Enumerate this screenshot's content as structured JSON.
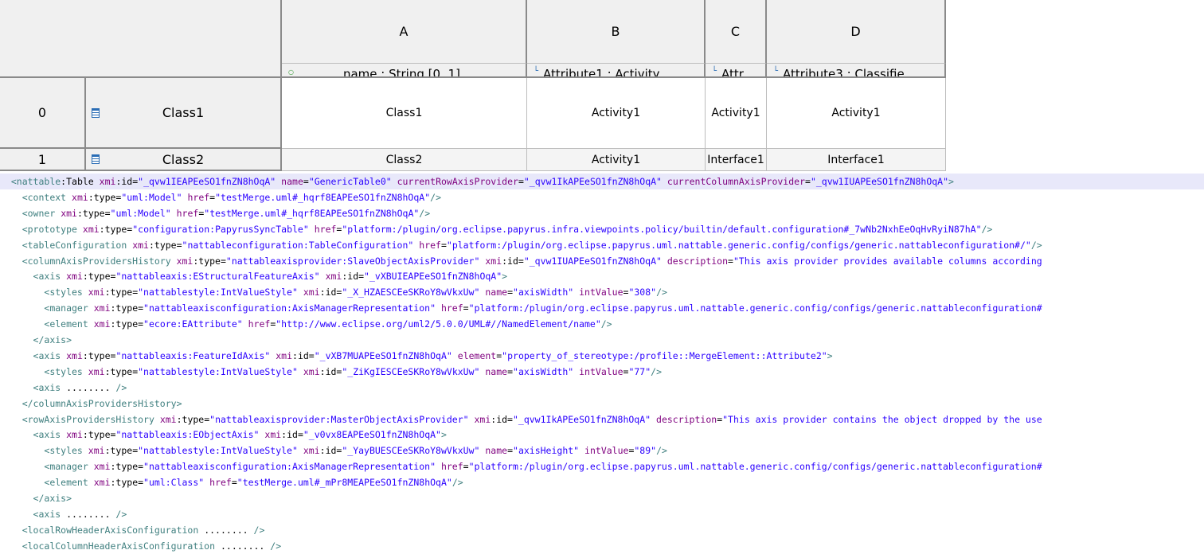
{
  "table": {
    "columns": [
      {
        "letter": "A",
        "label": "name : String [0..1]",
        "icon": "feature-dot-icon"
      },
      {
        "letter": "B",
        "label": "Attribute1 : Activity",
        "icon": "attribute-icon"
      },
      {
        "letter": "C",
        "label": "Attr",
        "icon": "attribute-icon"
      },
      {
        "letter": "D",
        "label": "Attribute3 : Classifie",
        "icon": "attribute-icon"
      }
    ],
    "rows": [
      {
        "index": "0",
        "label": "Class1",
        "cells": [
          "Class1",
          "Activity1",
          "Activity1",
          "Activity1"
        ]
      },
      {
        "index": "1",
        "label": "Class2",
        "cells": [
          "Class2",
          "Activity1",
          "Interface1",
          "Interface1"
        ]
      }
    ]
  },
  "xmi": {
    "lines": [
      {
        "indent": 2,
        "tag_prefix": "<",
        "tag": "nattable",
        "tag_rest": ":Table",
        "parts": [
          [
            "attr",
            "xmi"
          ],
          [
            "plain",
            ":id="
          ],
          [
            "val",
            "\"_qvw1IEAPEeSO1fnZN8hOqA\""
          ],
          [
            "plain",
            " "
          ],
          [
            "attr",
            "name"
          ],
          [
            "plain",
            "="
          ],
          [
            "val",
            "\"GenericTable0\""
          ],
          [
            "plain",
            " "
          ],
          [
            "attr",
            "currentRowAxisProvider"
          ],
          [
            "plain",
            "="
          ],
          [
            "val",
            "\"_qvw1IkAPEeSO1fnZN8hOqA\""
          ],
          [
            "plain",
            " "
          ],
          [
            "attr",
            "currentColumnAxisProvider"
          ],
          [
            "plain",
            "="
          ],
          [
            "val",
            "\"_qvw1IUAPEeSO1fnZN8hOqA\""
          ],
          [
            "tag",
            ">"
          ]
        ]
      },
      {
        "indent": 4,
        "tag_prefix": "<",
        "tag": "context",
        "tag_rest": "",
        "parts": [
          [
            "attr",
            "xmi"
          ],
          [
            "plain",
            ":type="
          ],
          [
            "val",
            "\"uml:Model\""
          ],
          [
            "plain",
            " "
          ],
          [
            "attr",
            "href"
          ],
          [
            "plain",
            "="
          ],
          [
            "val",
            "\"testMerge.uml#_hqrf8EAPEeSO1fnZN8hOqA\""
          ],
          [
            "tag",
            "/>"
          ]
        ]
      },
      {
        "indent": 4,
        "tag_prefix": "<",
        "tag": "owner",
        "tag_rest": "",
        "parts": [
          [
            "attr",
            "xmi"
          ],
          [
            "plain",
            ":type="
          ],
          [
            "val",
            "\"uml:Model\""
          ],
          [
            "plain",
            " "
          ],
          [
            "attr",
            "href"
          ],
          [
            "plain",
            "="
          ],
          [
            "val",
            "\"testMerge.uml#_hqrf8EAPEeSO1fnZN8hOqA\""
          ],
          [
            "tag",
            "/>"
          ]
        ]
      },
      {
        "indent": 4,
        "tag_prefix": "<",
        "tag": "prototype",
        "tag_rest": "",
        "parts": [
          [
            "attr",
            "xmi"
          ],
          [
            "plain",
            ":type="
          ],
          [
            "val",
            "\"configuration:PapyrusSyncTable\""
          ],
          [
            "plain",
            " "
          ],
          [
            "attr",
            "href"
          ],
          [
            "plain",
            "="
          ],
          [
            "val",
            "\"platform:/plugin/org.eclipse.papyrus.infra.viewpoints.policy/builtin/default.configuration#_7wNb2NxhEeOqHvRyiN87hA\""
          ],
          [
            "tag",
            "/>"
          ]
        ]
      },
      {
        "indent": 4,
        "tag_prefix": "<",
        "tag": "tableConfiguration",
        "tag_rest": "",
        "parts": [
          [
            "attr",
            "xmi"
          ],
          [
            "plain",
            ":type="
          ],
          [
            "val",
            "\"nattableconfiguration:TableConfiguration\""
          ],
          [
            "plain",
            " "
          ],
          [
            "attr",
            "href"
          ],
          [
            "plain",
            "="
          ],
          [
            "val",
            "\"platform:/plugin/org.eclipse.papyrus.uml.nattable.generic.config/configs/generic.nattableconfiguration#/\""
          ],
          [
            "tag",
            "/>"
          ]
        ]
      },
      {
        "indent": 4,
        "tag_prefix": "<",
        "tag": "columnAxisProvidersHistory",
        "tag_rest": "",
        "parts": [
          [
            "attr",
            "xmi"
          ],
          [
            "plain",
            ":type="
          ],
          [
            "val",
            "\"nattableaxisprovider:SlaveObjectAxisProvider\""
          ],
          [
            "plain",
            " "
          ],
          [
            "attr",
            "xmi"
          ],
          [
            "plain",
            ":id="
          ],
          [
            "val",
            "\"_qvw1IUAPEeSO1fnZN8hOqA\""
          ],
          [
            "plain",
            " "
          ],
          [
            "attr",
            "description"
          ],
          [
            "plain",
            "="
          ],
          [
            "val",
            "\"This axis provider provides available columns according"
          ]
        ]
      },
      {
        "indent": 6,
        "tag_prefix": "<",
        "tag": "axis",
        "tag_rest": "",
        "parts": [
          [
            "attr",
            "xmi"
          ],
          [
            "plain",
            ":type="
          ],
          [
            "val",
            "\"nattableaxis:EStructuralFeatureAxis\""
          ],
          [
            "plain",
            " "
          ],
          [
            "attr",
            "xmi"
          ],
          [
            "plain",
            ":id="
          ],
          [
            "val",
            "\"_vXBUIEAPEeSO1fnZN8hOqA\""
          ],
          [
            "tag",
            ">"
          ]
        ]
      },
      {
        "indent": 8,
        "tag_prefix": "<",
        "tag": "styles",
        "tag_rest": "",
        "parts": [
          [
            "attr",
            "xmi"
          ],
          [
            "plain",
            ":type="
          ],
          [
            "val",
            "\"nattablestyle:IntValueStyle\""
          ],
          [
            "plain",
            " "
          ],
          [
            "attr",
            "xmi"
          ],
          [
            "plain",
            ":id="
          ],
          [
            "val",
            "\"_X_HZAESCEeSKRoY8wVkxUw\""
          ],
          [
            "plain",
            " "
          ],
          [
            "attr",
            "name"
          ],
          [
            "plain",
            "="
          ],
          [
            "val",
            "\"axisWidth\""
          ],
          [
            "plain",
            " "
          ],
          [
            "attr",
            "intValue"
          ],
          [
            "plain",
            "="
          ],
          [
            "val",
            "\"308\""
          ],
          [
            "tag",
            "/>"
          ]
        ]
      },
      {
        "indent": 8,
        "tag_prefix": "<",
        "tag": "manager",
        "tag_rest": "",
        "parts": [
          [
            "attr",
            "xmi"
          ],
          [
            "plain",
            ":type="
          ],
          [
            "val",
            "\"nattableaxisconfiguration:AxisManagerRepresentation\""
          ],
          [
            "plain",
            " "
          ],
          [
            "attr",
            "href"
          ],
          [
            "plain",
            "="
          ],
          [
            "val",
            "\"platform:/plugin/org.eclipse.papyrus.uml.nattable.generic.config/configs/generic.nattableconfiguration#"
          ]
        ]
      },
      {
        "indent": 8,
        "tag_prefix": "<",
        "tag": "element",
        "tag_rest": "",
        "parts": [
          [
            "attr",
            "xmi"
          ],
          [
            "plain",
            ":type="
          ],
          [
            "val",
            "\"ecore:EAttribute\""
          ],
          [
            "plain",
            " "
          ],
          [
            "attr",
            "href"
          ],
          [
            "plain",
            "="
          ],
          [
            "val",
            "\"http://www.eclipse.org/uml2/5.0.0/UML#//NamedElement/name\""
          ],
          [
            "tag",
            "/>"
          ]
        ]
      },
      {
        "indent": 6,
        "tag_prefix": "</",
        "tag": "axis",
        "tag_rest": "",
        "parts": [
          [
            "tag",
            ">"
          ]
        ]
      },
      {
        "indent": 6,
        "tag_prefix": "<",
        "tag": "axis",
        "tag_rest": "",
        "parts": [
          [
            "attr",
            "xmi"
          ],
          [
            "plain",
            ":type="
          ],
          [
            "val",
            "\"nattableaxis:FeatureIdAxis\""
          ],
          [
            "plain",
            " "
          ],
          [
            "attr",
            "xmi"
          ],
          [
            "plain",
            ":id="
          ],
          [
            "val",
            "\"_vXB7MUAPEeSO1fnZN8hOqA\""
          ],
          [
            "plain",
            " "
          ],
          [
            "attr",
            "element"
          ],
          [
            "plain",
            "="
          ],
          [
            "val",
            "\"property_of_stereotype:/profile::MergeElement::Attribute2\""
          ],
          [
            "tag",
            ">"
          ]
        ]
      },
      {
        "indent": 8,
        "tag_prefix": "<",
        "tag": "styles",
        "tag_rest": "",
        "parts": [
          [
            "attr",
            "xmi"
          ],
          [
            "plain",
            ":type="
          ],
          [
            "val",
            "\"nattablestyle:IntValueStyle\""
          ],
          [
            "plain",
            " "
          ],
          [
            "attr",
            "xmi"
          ],
          [
            "plain",
            ":id="
          ],
          [
            "val",
            "\"_ZiKgIESCEeSKRoY8wVkxUw\""
          ],
          [
            "plain",
            " "
          ],
          [
            "attr",
            "name"
          ],
          [
            "plain",
            "="
          ],
          [
            "val",
            "\"axisWidth\""
          ],
          [
            "plain",
            " "
          ],
          [
            "attr",
            "intValue"
          ],
          [
            "plain",
            "="
          ],
          [
            "val",
            "\"77\""
          ],
          [
            "tag",
            "/>"
          ]
        ]
      },
      {
        "indent": 6,
        "tag_prefix": "<",
        "tag": "axis",
        "tag_rest": "",
        "parts": [
          [
            "plain",
            "........ "
          ],
          [
            "tag",
            "/>"
          ]
        ]
      },
      {
        "indent": 4,
        "tag_prefix": "</",
        "tag": "columnAxisProvidersHistory",
        "tag_rest": "",
        "parts": [
          [
            "tag",
            ">"
          ]
        ]
      },
      {
        "indent": 4,
        "tag_prefix": "<",
        "tag": "rowAxisProvidersHistory",
        "tag_rest": "",
        "parts": [
          [
            "attr",
            "xmi"
          ],
          [
            "plain",
            ":type="
          ],
          [
            "val",
            "\"nattableaxisprovider:MasterObjectAxisProvider\""
          ],
          [
            "plain",
            " "
          ],
          [
            "attr",
            "xmi"
          ],
          [
            "plain",
            ":id="
          ],
          [
            "val",
            "\"_qvw1IkAPEeSO1fnZN8hOqA\""
          ],
          [
            "plain",
            " "
          ],
          [
            "attr",
            "description"
          ],
          [
            "plain",
            "="
          ],
          [
            "val",
            "\"This axis provider contains the object dropped by the use"
          ]
        ]
      },
      {
        "indent": 6,
        "tag_prefix": "<",
        "tag": "axis",
        "tag_rest": "",
        "parts": [
          [
            "attr",
            "xmi"
          ],
          [
            "plain",
            ":type="
          ],
          [
            "val",
            "\"nattableaxis:EObjectAxis\""
          ],
          [
            "plain",
            " "
          ],
          [
            "attr",
            "xmi"
          ],
          [
            "plain",
            ":id="
          ],
          [
            "val",
            "\"_v0vx8EAPEeSO1fnZN8hOqA\""
          ],
          [
            "tag",
            ">"
          ]
        ]
      },
      {
        "indent": 8,
        "tag_prefix": "<",
        "tag": "styles",
        "tag_rest": "",
        "parts": [
          [
            "attr",
            "xmi"
          ],
          [
            "plain",
            ":type="
          ],
          [
            "val",
            "\"nattablestyle:IntValueStyle\""
          ],
          [
            "plain",
            " "
          ],
          [
            "attr",
            "xmi"
          ],
          [
            "plain",
            ":id="
          ],
          [
            "val",
            "\"_YayBUESCEeSKRoY8wVkxUw\""
          ],
          [
            "plain",
            " "
          ],
          [
            "attr",
            "name"
          ],
          [
            "plain",
            "="
          ],
          [
            "val",
            "\"axisHeight\""
          ],
          [
            "plain",
            " "
          ],
          [
            "attr",
            "intValue"
          ],
          [
            "plain",
            "="
          ],
          [
            "val",
            "\"89\""
          ],
          [
            "tag",
            "/>"
          ]
        ]
      },
      {
        "indent": 8,
        "tag_prefix": "<",
        "tag": "manager",
        "tag_rest": "",
        "parts": [
          [
            "attr",
            "xmi"
          ],
          [
            "plain",
            ":type="
          ],
          [
            "val",
            "\"nattableaxisconfiguration:AxisManagerRepresentation\""
          ],
          [
            "plain",
            " "
          ],
          [
            "attr",
            "href"
          ],
          [
            "plain",
            "="
          ],
          [
            "val",
            "\"platform:/plugin/org.eclipse.papyrus.uml.nattable.generic.config/configs/generic.nattableconfiguration#"
          ]
        ]
      },
      {
        "indent": 8,
        "tag_prefix": "<",
        "tag": "element",
        "tag_rest": "",
        "parts": [
          [
            "attr",
            "xmi"
          ],
          [
            "plain",
            ":type="
          ],
          [
            "val",
            "\"uml:Class\""
          ],
          [
            "plain",
            " "
          ],
          [
            "attr",
            "href"
          ],
          [
            "plain",
            "="
          ],
          [
            "val",
            "\"testMerge.uml#_mPr8MEAPEeSO1fnZN8hOqA\""
          ],
          [
            "tag",
            "/>"
          ]
        ]
      },
      {
        "indent": 6,
        "tag_prefix": "</",
        "tag": "axis",
        "tag_rest": "",
        "parts": [
          [
            "tag",
            ">"
          ]
        ]
      },
      {
        "indent": 6,
        "tag_prefix": "<",
        "tag": "axis",
        "tag_rest": "",
        "parts": [
          [
            "plain",
            "........ "
          ],
          [
            "tag",
            "/>"
          ]
        ]
      },
      {
        "indent": 4,
        "tag_prefix": "<",
        "tag": "localRowHeaderAxisConfiguration",
        "tag_rest": "",
        "parts": [
          [
            "plain",
            "........ "
          ],
          [
            "tag",
            "/>"
          ]
        ]
      },
      {
        "indent": 4,
        "tag_prefix": "<",
        "tag": "localColumnHeaderAxisConfiguration",
        "tag_rest": "",
        "parts": [
          [
            "plain",
            "........ "
          ],
          [
            "tag",
            "/>"
          ]
        ]
      }
    ]
  }
}
